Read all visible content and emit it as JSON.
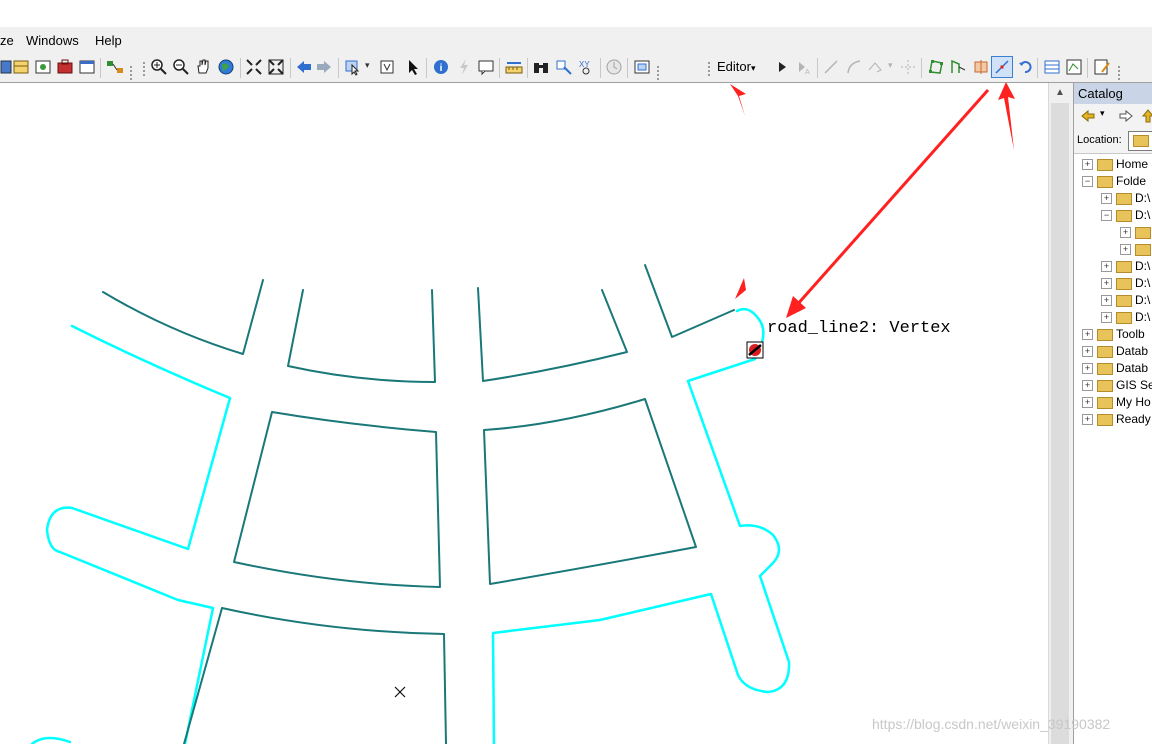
{
  "menu": {
    "items": [
      "ze",
      "Windows",
      "Help"
    ]
  },
  "toolbar": {
    "editor_label": "Editor",
    "editor_arrow": "▾"
  },
  "map": {
    "snap_tip": "road_line2: Vertex",
    "cursor_glyph": "✕"
  },
  "catalog": {
    "title": "Catalog",
    "location_label": "Location:",
    "tree": [
      {
        "sign": "+",
        "label": "Home",
        "indent": 0
      },
      {
        "sign": "−",
        "label": "Folde",
        "indent": 0
      },
      {
        "sign": "+",
        "label": "D:\\",
        "indent": 1
      },
      {
        "sign": "−",
        "label": "D:\\",
        "indent": 1
      },
      {
        "sign": "+",
        "label": "",
        "indent": 2
      },
      {
        "sign": "+",
        "label": "",
        "indent": 2
      },
      {
        "sign": "+",
        "label": "D:\\",
        "indent": 1
      },
      {
        "sign": "+",
        "label": "D:\\",
        "indent": 1
      },
      {
        "sign": "+",
        "label": "D:\\",
        "indent": 1
      },
      {
        "sign": "+",
        "label": "D:\\",
        "indent": 1
      },
      {
        "sign": "+",
        "label": "Toolb",
        "indent": 0
      },
      {
        "sign": "+",
        "label": "Datab",
        "indent": 0
      },
      {
        "sign": "+",
        "label": "Datab",
        "indent": 0
      },
      {
        "sign": "+",
        "label": "GIS Se",
        "indent": 0
      },
      {
        "sign": "+",
        "label": "My Ho",
        "indent": 0
      },
      {
        "sign": "+",
        "label": "Ready",
        "indent": 0
      }
    ]
  },
  "watermark": "https://blog.csdn.net/weixin_39190382",
  "colors": {
    "buffer_line": "#00ffff",
    "road_line": "#1a7878",
    "annotation_arrow": "#ff2020",
    "active_tool": "#3c7fd0"
  }
}
